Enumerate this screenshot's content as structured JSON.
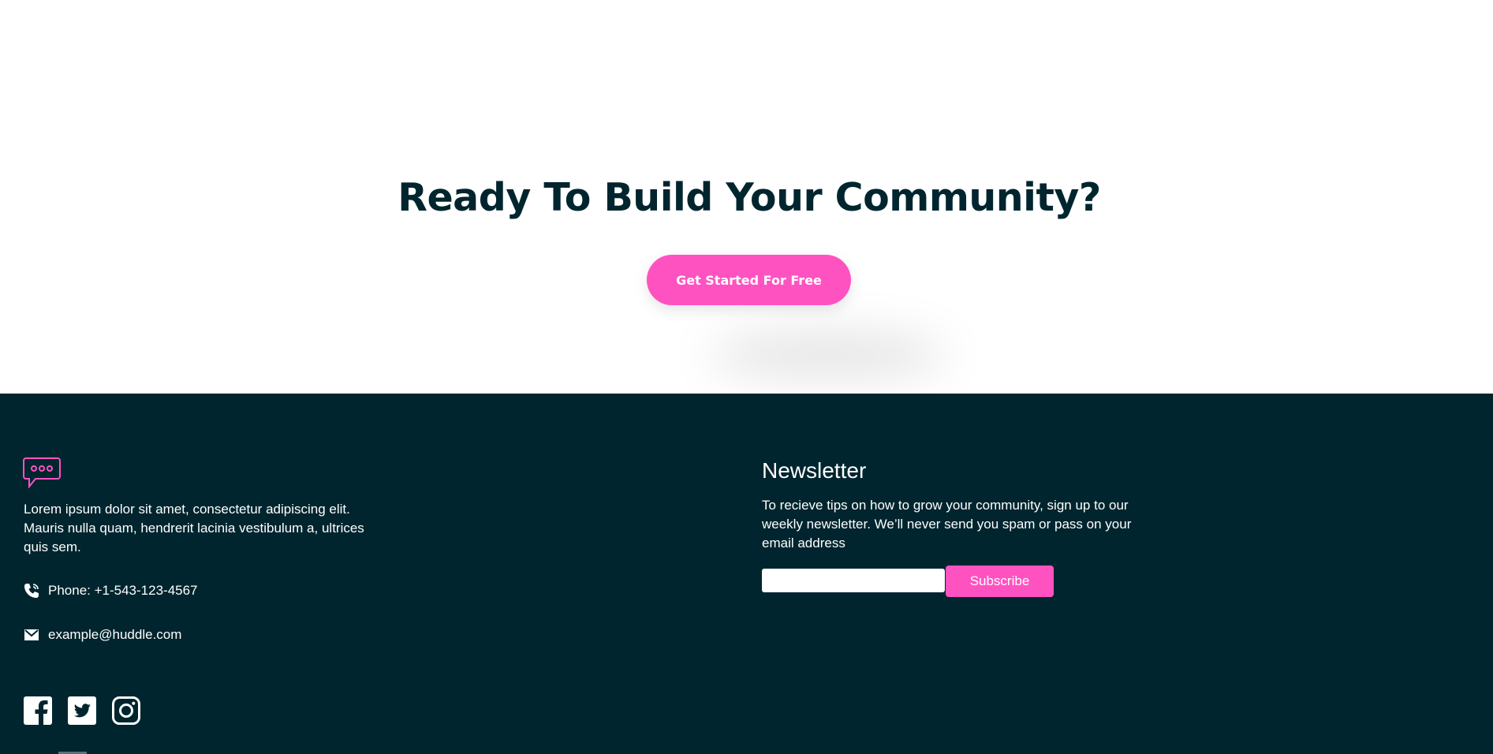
{
  "cta": {
    "title": "Ready To Build Your Community?",
    "button_label": "Get Started For Free"
  },
  "footer": {
    "logo_icon": "chat-bubble-icon",
    "description": "Lorem ipsum dolor sit amet, consectetur adipiscing elit. Mauris nulla quam, hendrerit lacinia vestibulum a, ultrices quis sem.",
    "phone": {
      "icon": "phone-icon",
      "text": "Phone: +1-543-123-4567"
    },
    "email": {
      "icon": "email-icon",
      "text": "example@huddle.com"
    },
    "socials": [
      {
        "icon": "facebook-icon"
      },
      {
        "icon": "twitter-icon"
      },
      {
        "icon": "instagram-icon"
      }
    ],
    "newsletter": {
      "title": "Newsletter",
      "text": "To recieve tips on how to grow your community, sign up to our weekly newsletter. We’ll never send you spam or pass on your email address",
      "input_value": "",
      "subscribe_label": "Subscribe"
    }
  },
  "colors": {
    "accent": "#ff52c1",
    "dark": "#00252e",
    "white": "#ffffff"
  }
}
